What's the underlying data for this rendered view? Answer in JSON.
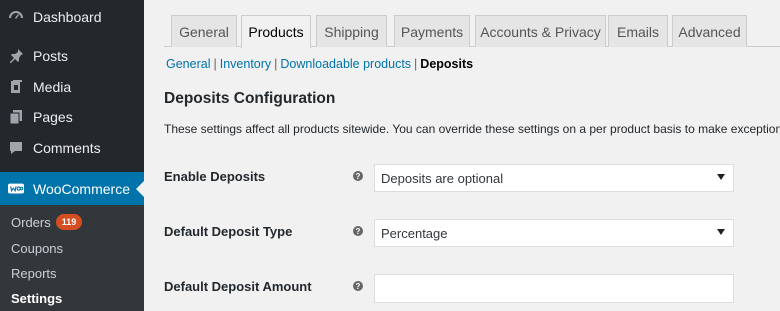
{
  "sidebar": {
    "items": [
      {
        "label": "Dashboard",
        "icon": "dashboard-icon"
      },
      {
        "label": "Posts",
        "icon": "pin-icon"
      },
      {
        "label": "Media",
        "icon": "media-icon"
      },
      {
        "label": "Pages",
        "icon": "pages-icon"
      },
      {
        "label": "Comments",
        "icon": "comments-icon"
      },
      {
        "label": "WooCommerce",
        "icon": "woo-icon"
      }
    ],
    "submenu": [
      {
        "label": "Orders",
        "badge": "119"
      },
      {
        "label": "Coupons"
      },
      {
        "label": "Reports"
      },
      {
        "label": "Settings"
      }
    ]
  },
  "tabs": [
    "General",
    "Products",
    "Shipping",
    "Payments",
    "Accounts & Privacy",
    "Emails",
    "Advanced"
  ],
  "subsections": [
    "General",
    "Inventory",
    "Downloadable products",
    "Deposits"
  ],
  "section": {
    "title": "Deposits Configuration",
    "description": "These settings affect all products sitewide. You can override these settings on a per product basis to make exceptions."
  },
  "fields": {
    "enable_deposits": {
      "label": "Enable Deposits",
      "value": "Deposits are optional"
    },
    "deposit_type": {
      "label": "Default Deposit Type",
      "value": "Percentage"
    },
    "deposit_amount": {
      "label": "Default Deposit Amount",
      "value": ""
    }
  },
  "colors": {
    "sidebar_bg": "#23282d",
    "accent": "#0073aa",
    "badge": "#d54e21"
  }
}
